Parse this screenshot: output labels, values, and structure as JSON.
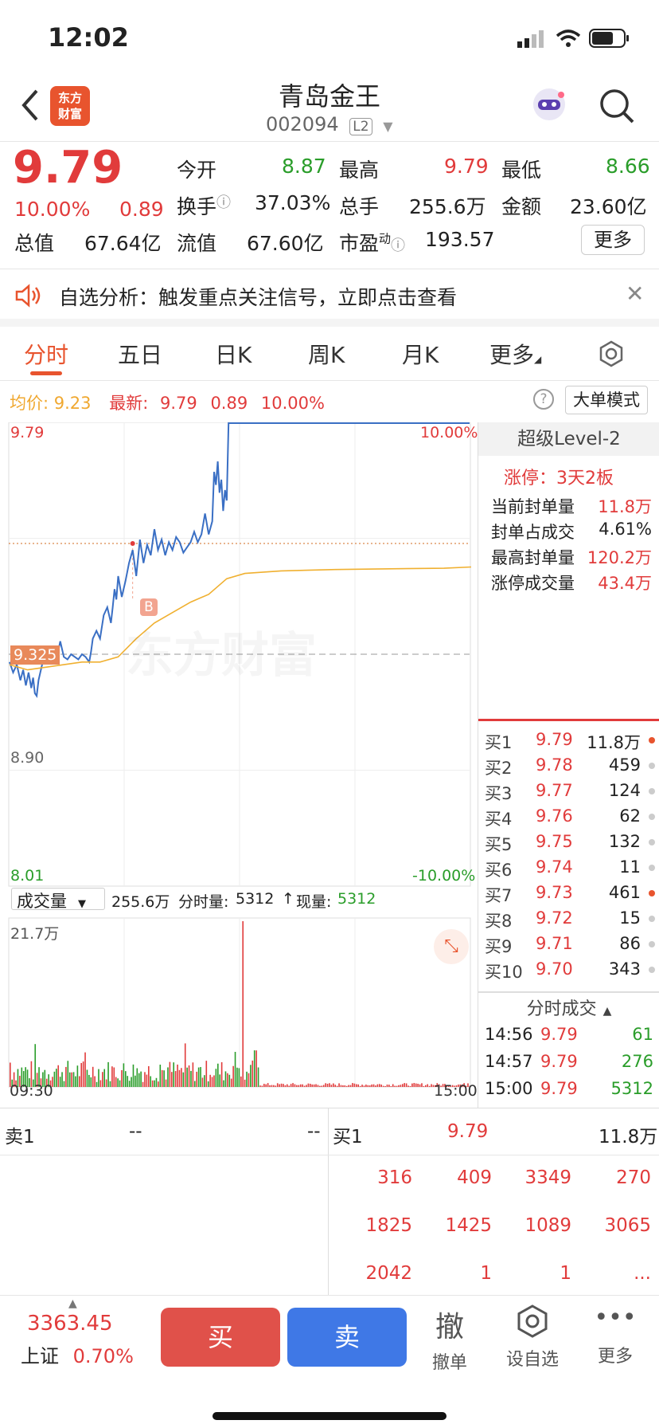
{
  "status": {
    "time": "12:02"
  },
  "header": {
    "app_logo": "东方\n财富",
    "title": "青岛金王",
    "code": "002094",
    "level_tag": "L2"
  },
  "quote": {
    "price": "9.79",
    "change_pct": "10.00%",
    "change": "0.89",
    "open_label": "今开",
    "open": "8.87",
    "high_label": "最高",
    "high": "9.79",
    "low_label": "最低",
    "low": "8.66",
    "turnover_label": "换手",
    "turnover": "37.03%",
    "volume_label": "总手",
    "volume": "255.6万",
    "amount_label": "金额",
    "amount": "23.60亿",
    "mktcap_label": "总值",
    "mktcap": "67.64亿",
    "float_label": "流值",
    "float": "67.60亿",
    "pe_label": "市盈",
    "pe_sup": "动",
    "pe": "193.57",
    "more": "更多"
  },
  "notice": {
    "text": "自选分析：触发重点关注信号，立即点击查看"
  },
  "tabs": [
    "分时",
    "五日",
    "日K",
    "周K",
    "月K",
    "更多"
  ],
  "info_bar": {
    "avg_label": "均价:",
    "avg": "9.23",
    "latest_label": "最新:",
    "latest": "9.79",
    "chg": "0.89",
    "pct": "10.00%",
    "mode_button": "大单模式"
  },
  "chart_labels": {
    "top_price": "9.79",
    "top_pct": "10.00%",
    "mid_price": "8.90",
    "bottom_price": "8.01",
    "bottom_pct": "-10.00%",
    "cursor_price": "9.325",
    "marker": "B",
    "watermark": "东方财富",
    "vol_max": "21.7万",
    "time_start": "09:30",
    "time_end": "15:00"
  },
  "vol_bar": {
    "select": "成交量",
    "total": "255.6万",
    "minute_label": "分时量:",
    "minute": "5312",
    "current_label": "现量:",
    "current": "5312"
  },
  "level2": {
    "title": "超级Level-2",
    "limit_title": "涨停：3天2板",
    "rows": [
      {
        "label": "当前封单量",
        "value": "11.8万"
      },
      {
        "label": "封单占成交",
        "value": "4.61%"
      },
      {
        "label": "最高封单量",
        "value": "120.2万"
      },
      {
        "label": "涨停成交量",
        "value": "43.4万"
      }
    ]
  },
  "bids": [
    {
      "label": "买1",
      "price": "9.79",
      "vol": "11.8万"
    },
    {
      "label": "买2",
      "price": "9.78",
      "vol": "459"
    },
    {
      "label": "买3",
      "price": "9.77",
      "vol": "124"
    },
    {
      "label": "买4",
      "price": "9.76",
      "vol": "62"
    },
    {
      "label": "买5",
      "price": "9.75",
      "vol": "132"
    },
    {
      "label": "买6",
      "price": "9.74",
      "vol": "11"
    },
    {
      "label": "买7",
      "price": "9.73",
      "vol": "461"
    },
    {
      "label": "买8",
      "price": "9.72",
      "vol": "15"
    },
    {
      "label": "买9",
      "price": "9.71",
      "vol": "86"
    },
    {
      "label": "买10",
      "price": "9.70",
      "vol": "343"
    }
  ],
  "ticks": {
    "title": "分时成交",
    "rows": [
      {
        "time": "14:56",
        "price": "9.79",
        "vol": "61"
      },
      {
        "time": "14:57",
        "price": "9.79",
        "vol": "276"
      },
      {
        "time": "15:00",
        "price": "9.79",
        "vol": "5312"
      }
    ]
  },
  "queue": {
    "sell_label": "卖1",
    "sell_a": "--",
    "sell_b": "--",
    "buy_label": "买1",
    "buy_price": "9.79",
    "buy_vol": "11.8万",
    "rows": [
      [
        "316",
        "409",
        "3349",
        "270"
      ],
      [
        "1825",
        "1425",
        "1089",
        "3065"
      ],
      [
        "2042",
        "1",
        "1",
        "..."
      ]
    ]
  },
  "footer": {
    "index_value": "3363.45",
    "index_name": "上证",
    "index_pct": "0.70%",
    "buy": "买",
    "sell": "卖",
    "cancel_glyph": "撤",
    "cancel": "撤单",
    "watch": "设自选",
    "more": "更多"
  },
  "chart_data": {
    "type": "line",
    "x_range": [
      "09:30",
      "15:00"
    ],
    "ylim": [
      8.01,
      9.79
    ],
    "y_ref": 8.9,
    "series": [
      {
        "name": "price",
        "color": "#3a6fc4",
        "x": [
          0,
          4,
          8,
          12,
          15,
          18,
          21,
          24,
          26,
          28,
          30,
          32,
          36,
          40,
          44,
          48,
          52,
          56,
          60,
          64,
          68,
          72,
          76,
          80,
          84,
          88,
          90,
          92,
          96,
          100,
          104,
          108,
          112,
          114,
          116,
          118,
          120,
          124,
          128,
          132,
          136,
          140,
          144,
          148,
          152,
          156,
          160,
          164,
          168,
          172,
          176,
          180,
          184,
          188,
          192,
          196,
          200,
          204,
          208,
          212,
          216,
          220,
          224,
          226,
          228,
          230,
          232,
          234,
          236,
          238,
          240,
          242,
          241
        ],
        "y": [
          8.87,
          8.83,
          8.86,
          8.8,
          8.84,
          8.78,
          8.83,
          8.77,
          8.81,
          8.75,
          8.74,
          8.8,
          8.86,
          8.93,
          8.88,
          8.92,
          8.88,
          8.95,
          8.89,
          8.88,
          8.9,
          8.89,
          8.88,
          8.9,
          8.89,
          8.87,
          8.91,
          8.96,
          8.99,
          8.96,
          9.05,
          9.08,
          9.02,
          9.08,
          9.15,
          9.11,
          9.2,
          9.12,
          9.18,
          9.25,
          9.3,
          9.2,
          9.34,
          9.25,
          9.32,
          9.28,
          9.38,
          9.3,
          9.34,
          9.28,
          9.33,
          9.3,
          9.35,
          9.33,
          9.29,
          9.31,
          9.33,
          9.37,
          9.33,
          9.36,
          9.44,
          9.36,
          9.41,
          9.6,
          9.55,
          9.64,
          9.52,
          9.57,
          9.45,
          9.53,
          9.49,
          9.79,
          9.79
        ]
      },
      {
        "name": "avg",
        "color": "#f0b030",
        "x": [
          0,
          20,
          40,
          60,
          80,
          100,
          120,
          140,
          160,
          180,
          200,
          220,
          240,
          260,
          300,
          360,
          420,
          480,
          510
        ],
        "y": [
          8.86,
          8.84,
          8.85,
          8.86,
          8.87,
          8.87,
          8.89,
          8.96,
          9.02,
          9.06,
          9.1,
          9.13,
          9.19,
          9.21,
          9.22,
          9.225,
          9.228,
          9.23,
          9.235
        ]
      }
    ],
    "volume": {
      "max": "21.7万",
      "spike_index": 121
    }
  }
}
